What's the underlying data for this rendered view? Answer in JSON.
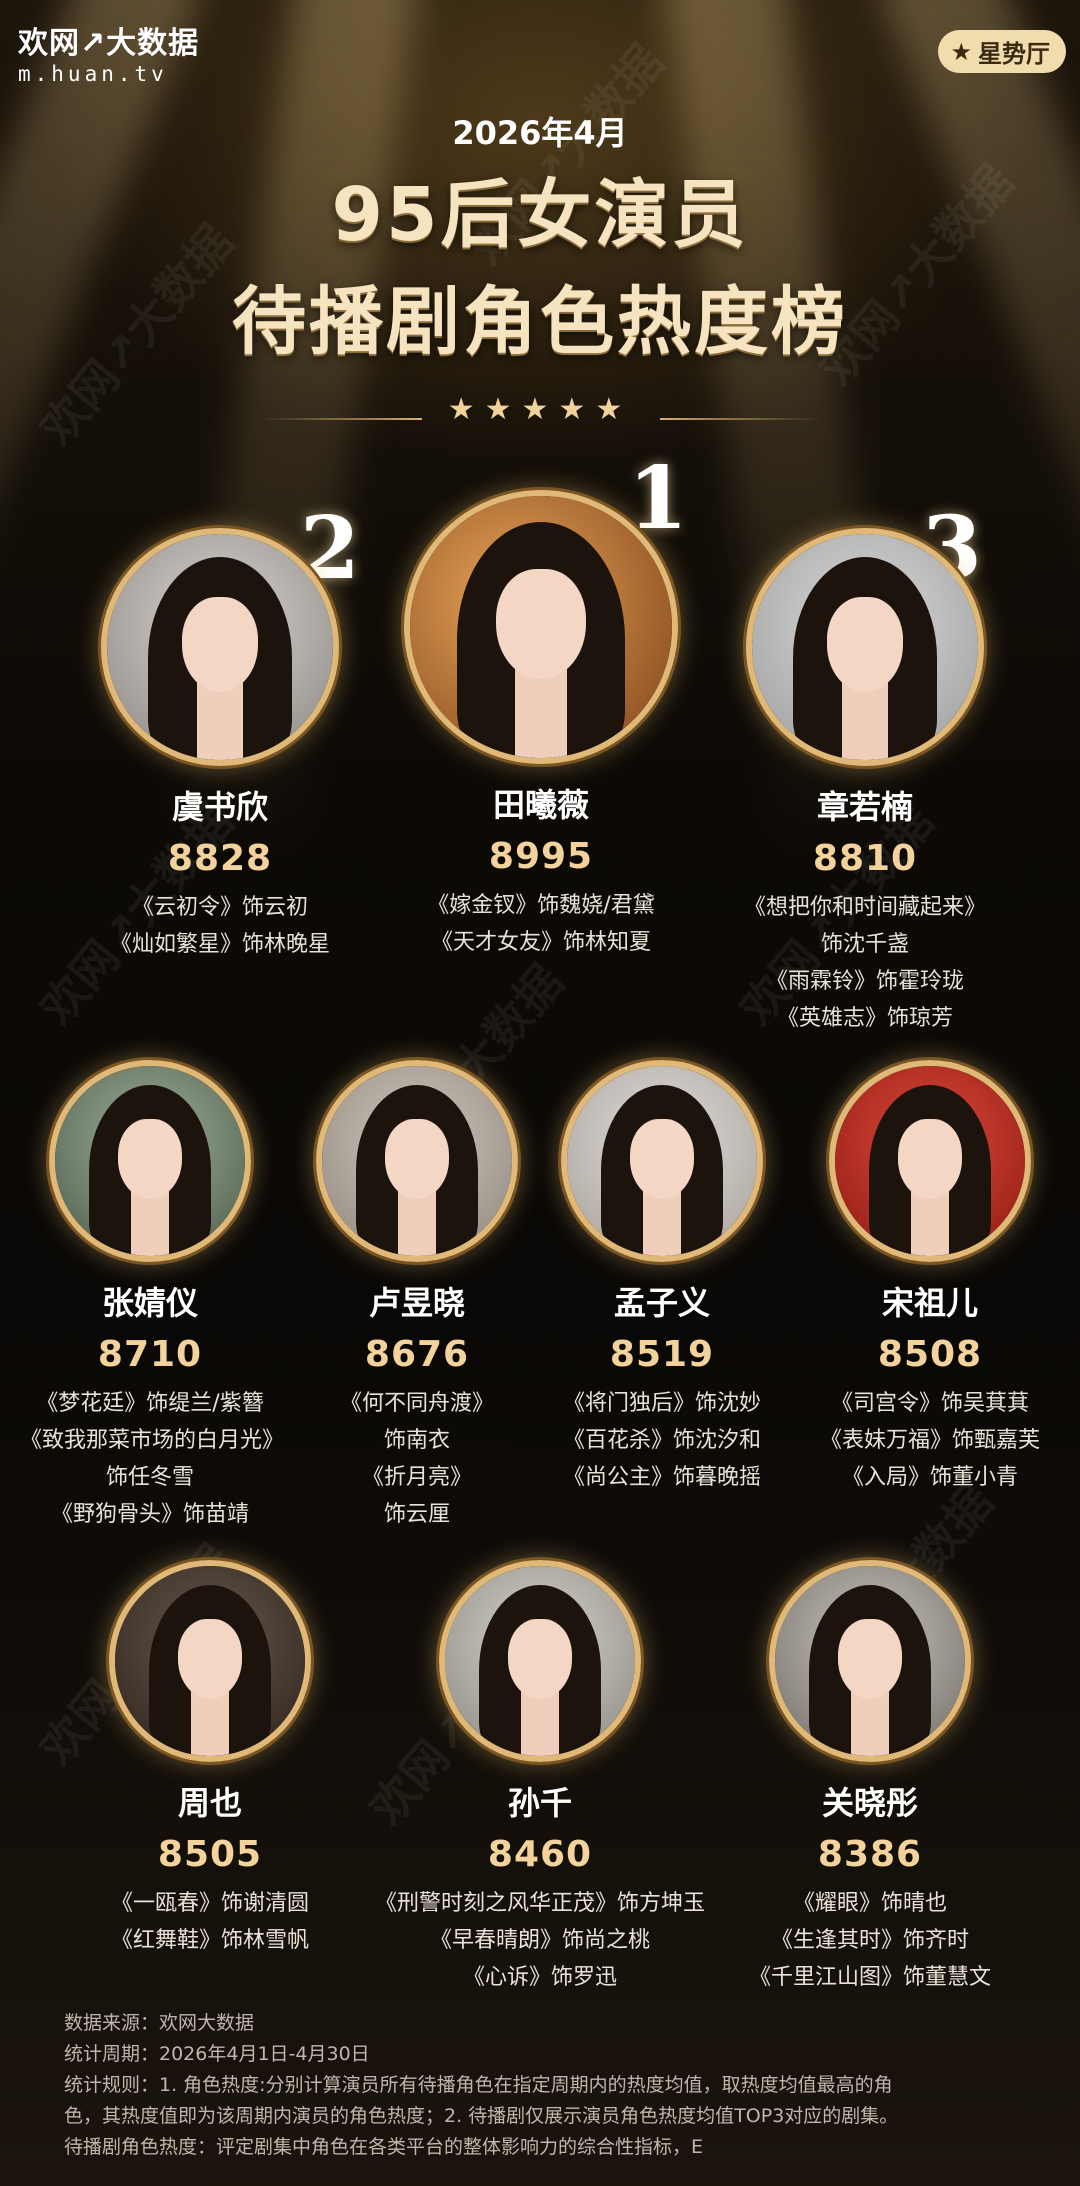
{
  "header": {
    "logo_line1": "欢网↗大数据",
    "logo_line2": "m.huan.tv",
    "badge": "星势厅",
    "date": "2026年4月",
    "title_line1": "95后女演员",
    "title_line2": "待播剧角色热度榜",
    "stars": "★★★★★"
  },
  "watermark": "欢网↗大数据",
  "ranks": {
    "first": "1",
    "second": "2",
    "third": "3"
  },
  "actresses": [
    {
      "name": "田曦薇",
      "score": "8995",
      "roles": [
        "《嫁金钗》饰魏娆/君黛",
        "《天才女友》饰林知夏"
      ]
    },
    {
      "name": "虞书欣",
      "score": "8828",
      "roles": [
        "《云初令》饰云初",
        "《灿如繁星》饰林晚星"
      ]
    },
    {
      "name": "章若楠",
      "score": "8810",
      "roles": [
        "《想把你和时间藏起来》",
        "饰沈千盏",
        "《雨霖铃》饰霍玲珑",
        "《英雄志》饰琼芳"
      ]
    },
    {
      "name": "张婧仪",
      "score": "8710",
      "roles": [
        "《梦花廷》饰缇兰/紫簪",
        "《致我那菜市场的白月光》",
        "饰任冬雪",
        "《野狗骨头》饰苗靖"
      ]
    },
    {
      "name": "卢昱晓",
      "score": "8676",
      "roles": [
        "《何不同舟渡》",
        "饰南衣",
        "《折月亮》",
        "饰云厘"
      ]
    },
    {
      "name": "孟子义",
      "score": "8519",
      "roles": [
        "《将门独后》饰沈妙",
        "《百花杀》饰沈汐和",
        "《尚公主》饰暮晚摇"
      ]
    },
    {
      "name": "宋祖儿",
      "score": "8508",
      "roles": [
        "《司宫令》饰吴萁萁",
        "《表妹万福》饰甄嘉芙",
        "《入局》饰董小青"
      ]
    },
    {
      "name": "周也",
      "score": "8505",
      "roles": [
        "《一瓯春》饰谢清圆",
        "《红舞鞋》饰林雪帆"
      ]
    },
    {
      "name": "孙千",
      "score": "8460",
      "roles": [
        "《刑警时刻之风华正茂》饰方坤玉",
        "《早春晴朗》饰尚之桃",
        "《心诉》饰罗迅"
      ]
    },
    {
      "name": "关晓彤",
      "score": "8386",
      "roles": [
        "《耀眼》饰晴也",
        "《生逢其时》饰齐时",
        "《千里江山图》饰董慧文"
      ]
    }
  ],
  "footer": {
    "source": "数据来源：欢网大数据",
    "period": "统计周期：2026年4月1日-4月30日",
    "rule_line1": "统计规则：1. 角色热度:分别计算演员所有待播角色在指定周期内的热度均值，取热度均值最高的角",
    "rule_line2": "色，其热度值即为该周期内演员的角色热度；2. 待播剧仅展示演员角色热度均值TOP3对应的剧集。",
    "rule_line3": "待播剧角色热度：评定剧集中角色在各类平台的整体影响力的综合性指标，E"
  }
}
